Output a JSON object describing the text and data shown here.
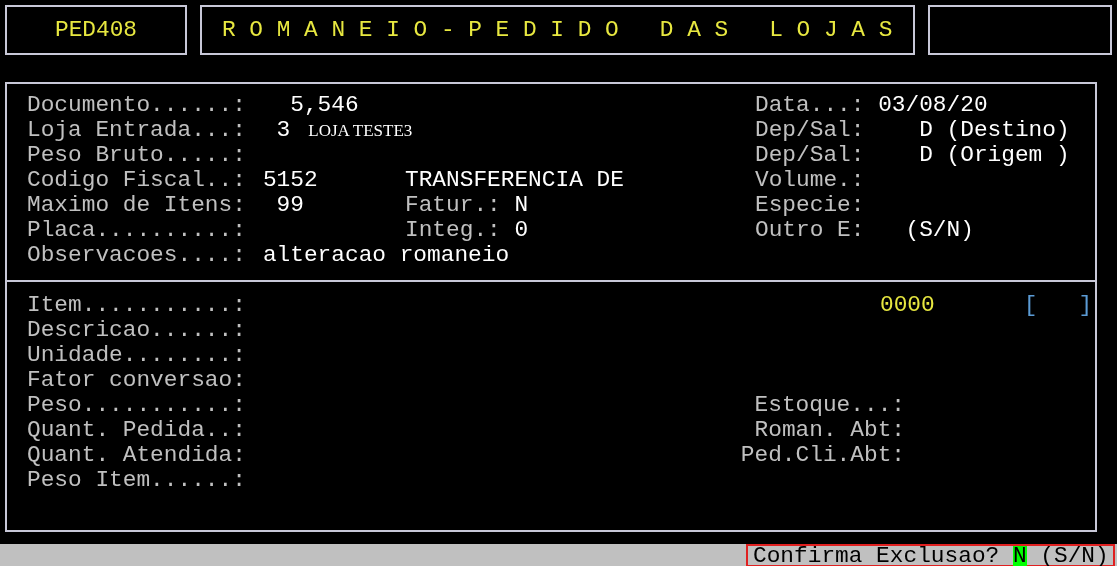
{
  "header": {
    "program_code": "PED408",
    "title": "R O M A N E I O - P E D I D O   D A S   L O J A S"
  },
  "order": {
    "rows": [
      {
        "left": {
          "label": "Documento......:",
          "value": "  5,546"
        },
        "right": {
          "label": "Data...:",
          "value": "03/08/20"
        }
      },
      {
        "left": {
          "label": "Loja Entrada...:",
          "value": " 3",
          "name": "LOJA TESTE3"
        },
        "right": {
          "label": "Dep/Sal:",
          "value": "   D (Destino)"
        }
      },
      {
        "left": {
          "label": "Peso Bruto.....:"
        },
        "right": {
          "label": "Dep/Sal:",
          "value": "   D (Origem )"
        }
      },
      {
        "left": {
          "label": "Codigo Fiscal..:",
          "value": "5152"
        },
        "middle": {
          "value": "TRANSFERENCIA DE"
        },
        "right": {
          "label": "Volume.:"
        }
      },
      {
        "left": {
          "label": "Maximo de Itens:",
          "value": " 99"
        },
        "middle": {
          "label": "Fatur.:",
          "value": "N"
        },
        "right": {
          "label": "Especie:"
        }
      },
      {
        "left": {
          "label": "Placa..........:"
        },
        "middle": {
          "label": "Integ.:",
          "value": "0"
        },
        "right": {
          "label": "Outro E:",
          "value": "  (S/N)"
        }
      },
      {
        "left": {
          "label": "Observacoes....:",
          "value": "alteracao romaneio"
        }
      }
    ]
  },
  "item": {
    "code": "0000",
    "selector": "[   ]",
    "rows": [
      {
        "label": "Item...........:"
      },
      {
        "label": "Descricao......:"
      },
      {
        "label": "Unidade........:"
      },
      {
        "label": "Fator conversao:"
      },
      {
        "label": "Peso...........:",
        "right_label": "Estoque...:"
      },
      {
        "label": "Quant. Pedida..:",
        "right_label": "Roman. Abt:"
      },
      {
        "label": "Quant. Atendida:",
        "right_label": "Ped.Cli.Abt:"
      },
      {
        "label": "Peso Item......:"
      }
    ]
  },
  "prompt": {
    "question": "Confirma Exclusao?",
    "answer": "N",
    "options": "(S/N)"
  }
}
